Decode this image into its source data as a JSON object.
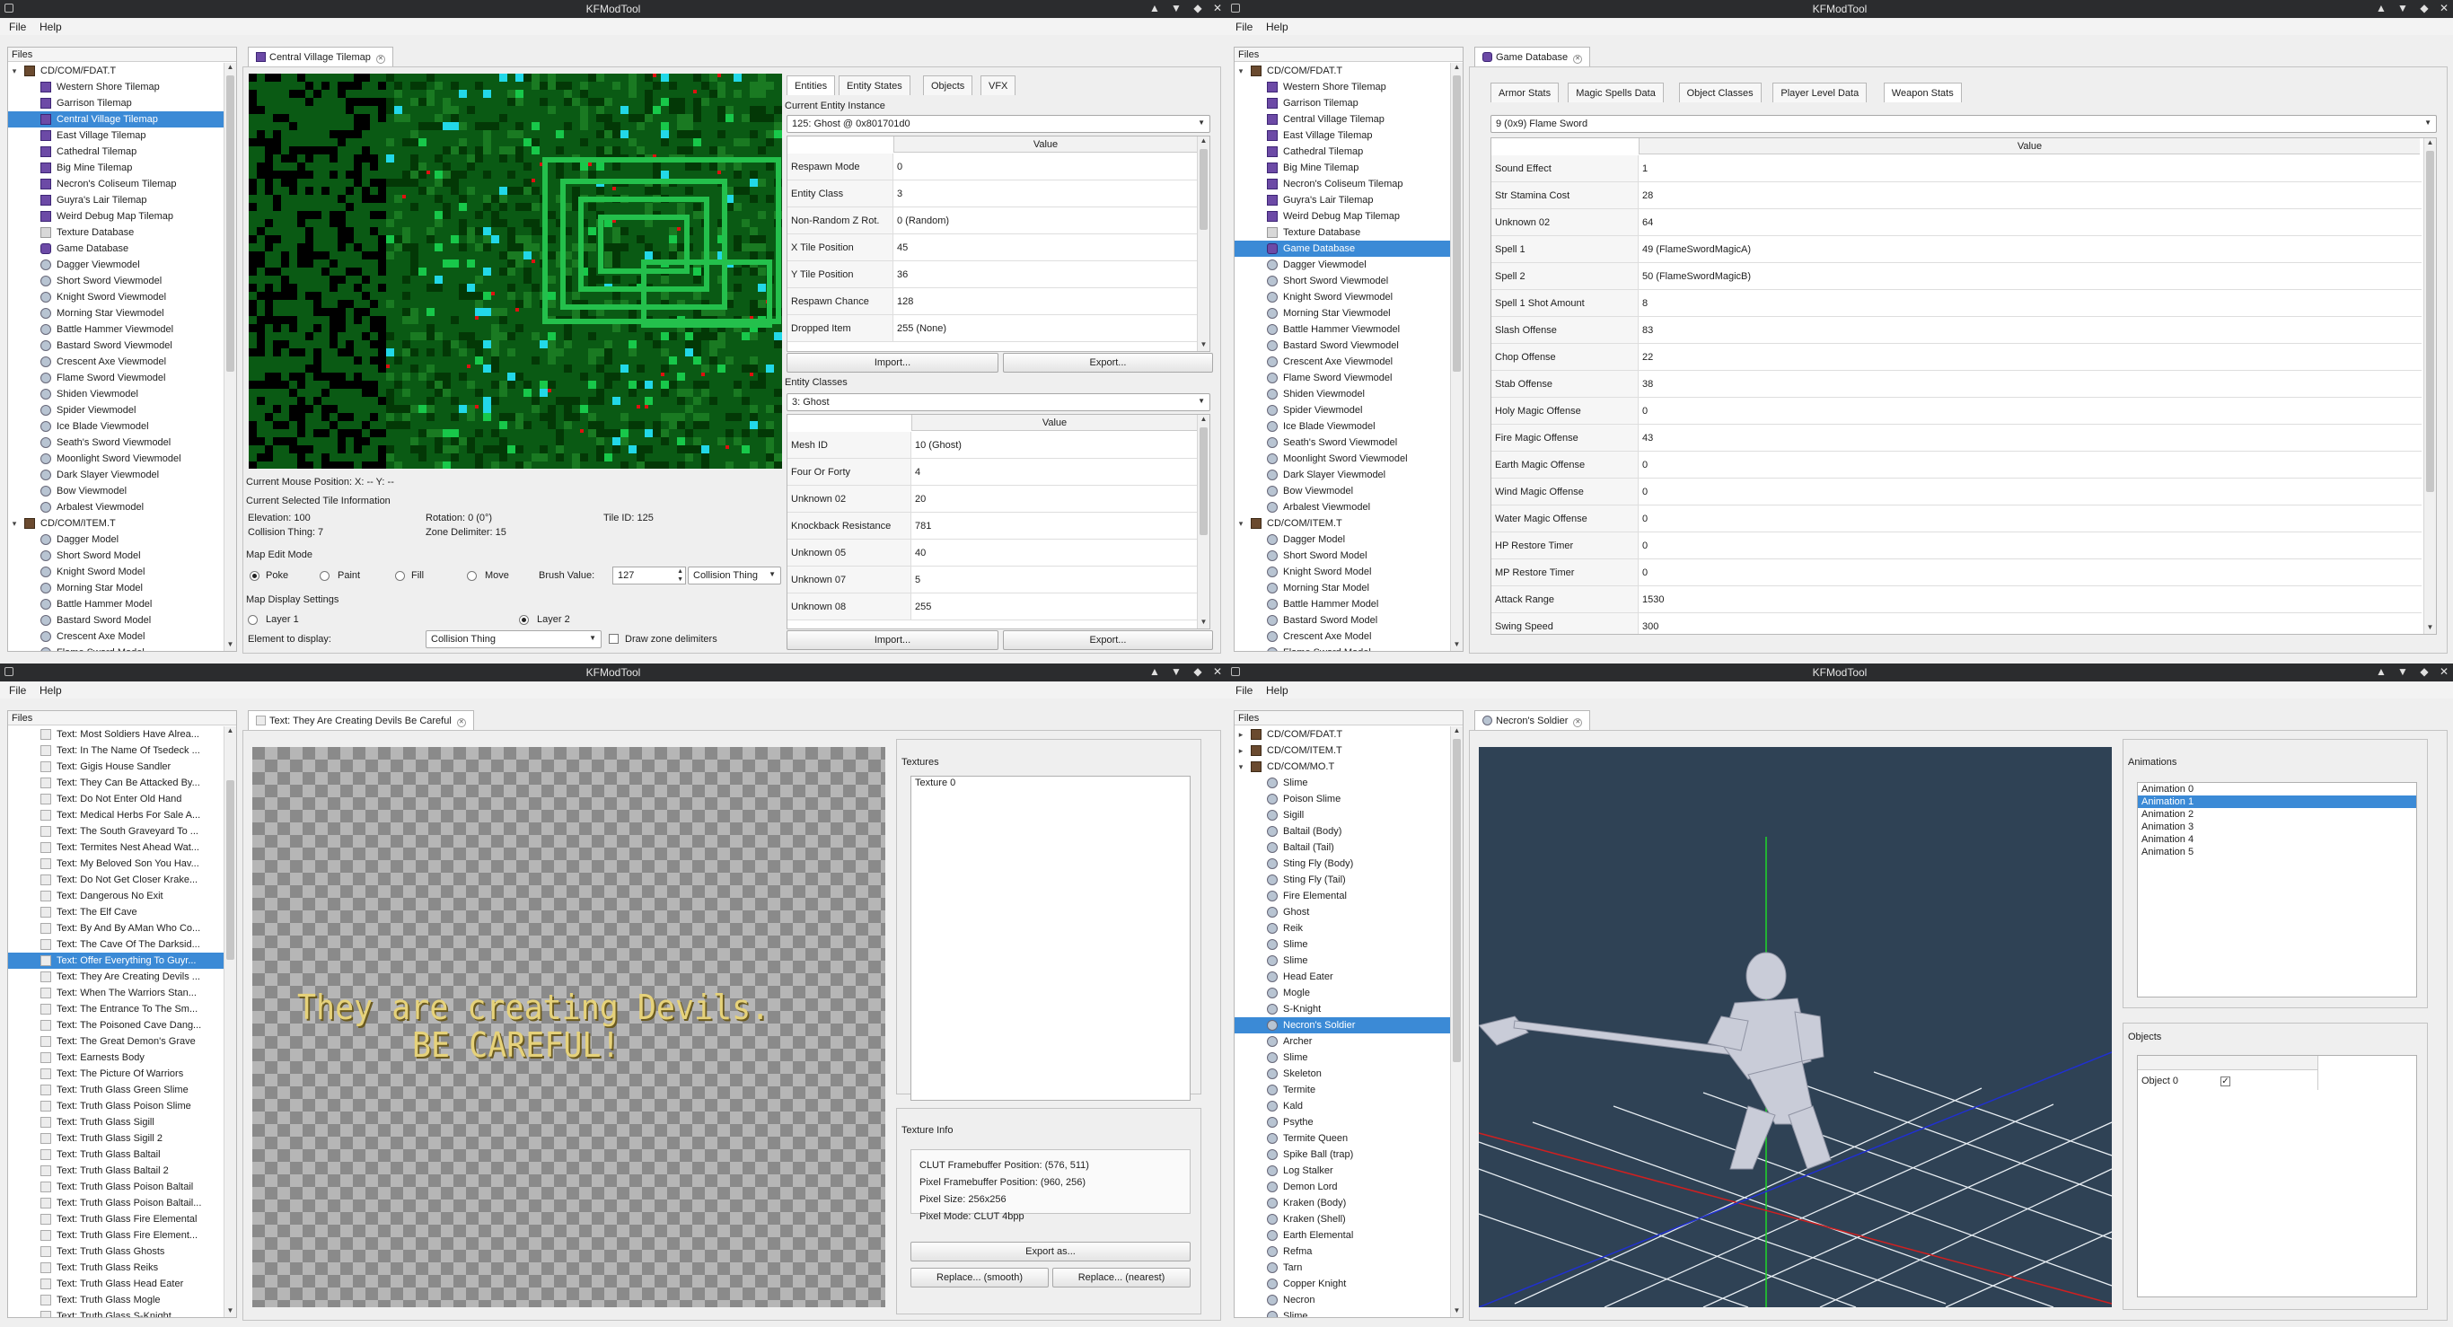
{
  "app_title": "KFModTool",
  "menu": {
    "file": "File",
    "help": "Help"
  },
  "files_header": "Files",
  "tree1": [
    {
      "label": "CD/COM/FDAT.T",
      "depth": 0,
      "icon": "file",
      "exp": "down"
    },
    {
      "label": "Western Shore Tilemap",
      "depth": 1,
      "icon": "tile"
    },
    {
      "label": "Garrison Tilemap",
      "depth": 1,
      "icon": "tile"
    },
    {
      "label": "Central Village Tilemap",
      "depth": 1,
      "icon": "tile",
      "sel": true
    },
    {
      "label": "East Village Tilemap",
      "depth": 1,
      "icon": "tile"
    },
    {
      "label": "Cathedral Tilemap",
      "depth": 1,
      "icon": "tile"
    },
    {
      "label": "Big Mine Tilemap",
      "depth": 1,
      "icon": "tile"
    },
    {
      "label": "Necron's Coliseum Tilemap",
      "depth": 1,
      "icon": "tile"
    },
    {
      "label": "Guyra's Lair Tilemap",
      "depth": 1,
      "icon": "tile"
    },
    {
      "label": "Weird Debug Map Tilemap",
      "depth": 1,
      "icon": "tile"
    },
    {
      "label": "Texture Database",
      "depth": 1,
      "icon": "tex"
    },
    {
      "label": "Game Database",
      "depth": 1,
      "icon": "db"
    },
    {
      "label": "Dagger Viewmodel",
      "depth": 1,
      "icon": "model"
    },
    {
      "label": "Short Sword Viewmodel",
      "depth": 1,
      "icon": "model"
    },
    {
      "label": "Knight Sword Viewmodel",
      "depth": 1,
      "icon": "model"
    },
    {
      "label": "Morning Star Viewmodel",
      "depth": 1,
      "icon": "model"
    },
    {
      "label": "Battle Hammer Viewmodel",
      "depth": 1,
      "icon": "model"
    },
    {
      "label": "Bastard Sword Viewmodel",
      "depth": 1,
      "icon": "model"
    },
    {
      "label": "Crescent Axe Viewmodel",
      "depth": 1,
      "icon": "model"
    },
    {
      "label": "Flame Sword Viewmodel",
      "depth": 1,
      "icon": "model"
    },
    {
      "label": "Shiden Viewmodel",
      "depth": 1,
      "icon": "model"
    },
    {
      "label": "Spider Viewmodel",
      "depth": 1,
      "icon": "model"
    },
    {
      "label": "Ice Blade Viewmodel",
      "depth": 1,
      "icon": "model"
    },
    {
      "label": "Seath's Sword Viewmodel",
      "depth": 1,
      "icon": "model"
    },
    {
      "label": "Moonlight Sword Viewmodel",
      "depth": 1,
      "icon": "model"
    },
    {
      "label": "Dark Slayer Viewmodel",
      "depth": 1,
      "icon": "model"
    },
    {
      "label": "Bow Viewmodel",
      "depth": 1,
      "icon": "model"
    },
    {
      "label": "Arbalest Viewmodel",
      "depth": 1,
      "icon": "model"
    },
    {
      "label": "CD/COM/ITEM.T",
      "depth": 0,
      "icon": "file",
      "exp": "down"
    },
    {
      "label": "Dagger Model",
      "depth": 1,
      "icon": "model"
    },
    {
      "label": "Short Sword Model",
      "depth": 1,
      "icon": "model"
    },
    {
      "label": "Knight Sword Model",
      "depth": 1,
      "icon": "model"
    },
    {
      "label": "Morning Star Model",
      "depth": 1,
      "icon": "model"
    },
    {
      "label": "Battle Hammer Model",
      "depth": 1,
      "icon": "model"
    },
    {
      "label": "Bastard Sword Model",
      "depth": 1,
      "icon": "model"
    },
    {
      "label": "Crescent Axe Model",
      "depth": 1,
      "icon": "model"
    },
    {
      "label": "Flame Sword Model",
      "depth": 1,
      "icon": "model"
    }
  ],
  "tree2_sel": "Game Database",
  "tree3": [
    "Text: Most Soldiers Have Alrea...",
    "Text: In The Name Of Tsedeck ...",
    "Text: Gigis House Sandler",
    "Text: They Can Be Attacked By...",
    "Text: Do Not Enter Old Hand",
    "Text: Medical Herbs For Sale A...",
    "Text: The South Graveyard To ...",
    "Text: Termites Nest Ahead Wat...",
    "Text: My Beloved Son You Hav...",
    "Text: Do Not Get Closer Krake...",
    "Text: Dangerous No Exit",
    "Text: The Elf Cave",
    "Text: By And By AMan Who Co...",
    "Text: The Cave Of The Darksid...",
    "Text: Offer Everything To Guyr...",
    "Text: They Are Creating Devils ...",
    "Text: When The Warriors Stan...",
    "Text: The Entrance To The Sm...",
    "Text: The Poisoned Cave Dang...",
    "Text: The Great Demon's Grave",
    "Text: Earnests Body",
    "Text: The Picture Of Warriors",
    "Text: Truth Glass Green Slime",
    "Text: Truth Glass Poison Slime",
    "Text: Truth Glass Sigill",
    "Text: Truth Glass Sigill 2",
    "Text: Truth Glass Baltail",
    "Text: Truth Glass Baltail 2",
    "Text: Truth Glass Poison Baltail",
    "Text: Truth Glass Poison Baltail...",
    "Text: Truth Glass Fire Elemental",
    "Text: Truth Glass Fire Element...",
    "Text: Truth Glass Ghosts",
    "Text: Truth Glass Reiks",
    "Text: Truth Glass Head Eater",
    "Text: Truth Glass Mogle",
    "Text: Truth Glass S-Knight"
  ],
  "tree3_sel_index": 14,
  "tree4_files": [
    "CD/COM/FDAT.T",
    "CD/COM/ITEM.T",
    "CD/COM/MO.T"
  ],
  "tree4_items": [
    "Slime",
    "Poison Slime",
    "Sigill",
    "Baltail (Body)",
    "Baltail (Tail)",
    "Sting Fly (Body)",
    "Sting Fly (Tail)",
    "Fire Elemental",
    "Ghost",
    "Reik",
    "Slime",
    "Slime",
    "Head Eater",
    "Mogle",
    "S-Knight",
    "Necron's Soldier",
    "Archer",
    "Slime",
    "Skeleton",
    "Termite",
    "Kald",
    "Psythe",
    "Termite Queen",
    "Spike Ball (trap)",
    "Log Stalker",
    "Demon Lord",
    "Kraken (Body)",
    "Kraken (Shell)",
    "Earth Elemental",
    "Refma",
    "Tarn",
    "Copper Knight",
    "Necron",
    "Slime"
  ],
  "tree4_sel_index": 15,
  "w1": {
    "tab": "Central Village Tilemap",
    "subtabs": [
      "Entities",
      "Entity States",
      "Objects",
      "VFX"
    ],
    "cur_inst_label": "Current Entity Instance",
    "cur_inst": "125: Ghost @ 0x801701d0",
    "value_header": "Value",
    "inst_rows": [
      [
        "Respawn Mode",
        "0"
      ],
      [
        "Entity Class",
        "3"
      ],
      [
        "Non-Random Z Rot.",
        "0 (Random)"
      ],
      [
        "X Tile Position",
        "45"
      ],
      [
        "Y Tile Position",
        "36"
      ],
      [
        "Respawn Chance",
        "128"
      ],
      [
        "Dropped Item",
        "255 (None)"
      ]
    ],
    "import": "Import...",
    "export": "Export...",
    "entity_classes_label": "Entity Classes",
    "entity_class": "3: Ghost",
    "class_rows": [
      [
        "Mesh ID",
        "10 (Ghost)"
      ],
      [
        "Four Or Forty",
        "4"
      ],
      [
        "Unknown 02",
        "20"
      ],
      [
        "Knockback Resistance",
        "781"
      ],
      [
        "Unknown 05",
        "40"
      ],
      [
        "Unknown 07",
        "5"
      ],
      [
        "Unknown 08",
        "255"
      ]
    ],
    "mouse_pos": "Current Mouse Position: X: -- Y: --",
    "sel_tile_info": "Current Selected Tile Information",
    "elevation": "Elevation: 100",
    "rotation": "Rotation: 0 (0°)",
    "tile_id": "Tile ID: 125",
    "collision": "Collision Thing: 7",
    "zone_delim": "Zone Delimiter: 15",
    "edit_mode_label": "Map Edit Mode",
    "modes": [
      "Poke",
      "Paint",
      "Fill",
      "Move"
    ],
    "brush_label": "Brush Value:",
    "brush_value": "127",
    "brush_target": "Collision Thing",
    "display_label": "Map Display Settings",
    "layer1": "Layer 1",
    "layer2": "Layer 2",
    "element_label": "Element to display:",
    "element_value": "Collision Thing",
    "draw_zone": "Draw zone delimiters"
  },
  "w2": {
    "tab": "Game Database",
    "subtabs": [
      "Armor Stats",
      "Magic Spells Data",
      "Object Classes",
      "Player Level Data",
      "Weapon Stats"
    ],
    "weapon": "9 (0x9) Flame Sword",
    "value_header": "Value",
    "rows": [
      [
        "Sound Effect",
        "1"
      ],
      [
        "Str Stamina Cost",
        "28"
      ],
      [
        "Unknown 02",
        "64"
      ],
      [
        "Spell 1",
        "49 (FlameSwordMagicA)"
      ],
      [
        "Spell 2",
        "50 (FlameSwordMagicB)"
      ],
      [
        "Spell 1 Shot Amount",
        "8"
      ],
      [
        "Slash Offense",
        "83"
      ],
      [
        "Chop Offense",
        "22"
      ],
      [
        "Stab Offense",
        "38"
      ],
      [
        "Holy Magic Offense",
        "0"
      ],
      [
        "Fire Magic Offense",
        "43"
      ],
      [
        "Earth Magic Offense",
        "0"
      ],
      [
        "Wind Magic Offense",
        "0"
      ],
      [
        "Water Magic Offense",
        "0"
      ],
      [
        "HP Restore Timer",
        "0"
      ],
      [
        "MP Restore Timer",
        "0"
      ],
      [
        "Attack Range",
        "1530"
      ],
      [
        "Swing Speed",
        "300"
      ]
    ]
  },
  "w3": {
    "tab": "Text: They Are Creating Devils Be Careful",
    "preview_line1": "They are creating Devils.",
    "preview_line2": "BE CAREFUL!",
    "textures_label": "Textures",
    "texture0": "Texture 0",
    "texinfo_label": "Texture Info",
    "clut": "CLUT Framebuffer Position: (576, 511)",
    "pixel_fb": "Pixel Framebuffer Position: (960, 256)",
    "pixel_size": "Pixel Size: 256x256",
    "pixel_mode": "Pixel Mode: CLUT 4bpp",
    "export_as": "Export as...",
    "replace_smooth": "Replace... (smooth)",
    "replace_nearest": "Replace... (nearest)"
  },
  "w4": {
    "tab": "Necron's Soldier",
    "animations_label": "Animations",
    "animations": [
      "Animation 0",
      "Animation 1",
      "Animation 2",
      "Animation 3",
      "Animation 4",
      "Animation 5"
    ],
    "anim_sel_index": 1,
    "objects_label": "Objects",
    "object0": "Object 0",
    "object0_check": "✓"
  },
  "colors": {
    "selection": "#3b8ad6",
    "titlebar": "#2b2c2e",
    "map_bg": "#0a5a14",
    "viewport": "#2f4255",
    "preview_text": "#e6d27a"
  },
  "window_controls": [
    "▲",
    "▼",
    "◆",
    "✕"
  ]
}
